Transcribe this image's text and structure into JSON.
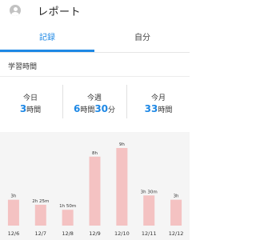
{
  "header": {
    "title": "レポート",
    "avatar_icon": "account-circle-icon"
  },
  "tabs": [
    {
      "label": "記録",
      "active": true
    },
    {
      "label": "自分",
      "active": false
    }
  ],
  "section_label": "学習時間",
  "summary": [
    {
      "label": "今日",
      "h": "3",
      "h_unit": "時間",
      "m": "",
      "m_unit": ""
    },
    {
      "label": "今週",
      "h": "6",
      "h_unit": "時間",
      "m": "30",
      "m_unit": "分"
    },
    {
      "label": "今月",
      "h": "33",
      "h_unit": "時間",
      "m": "",
      "m_unit": ""
    }
  ],
  "colors": {
    "accent": "#1e88e5",
    "bar": "#f4c2c2",
    "chart_bg": "#f5f5f5"
  },
  "chart_data": {
    "type": "bar",
    "categories": [
      "12/6",
      "12/7",
      "12/8",
      "12/9",
      "12/10",
      "12/11",
      "12/12"
    ],
    "values": [
      3,
      2.4167,
      1.8333,
      8,
      9,
      3.5,
      3
    ],
    "data_labels": [
      "3h",
      "2h 25m",
      "1h 50m",
      "8h",
      "9h",
      "3h 30m",
      "3h"
    ],
    "unit": "hours",
    "ylim": [
      0,
      9
    ],
    "grid": false
  }
}
